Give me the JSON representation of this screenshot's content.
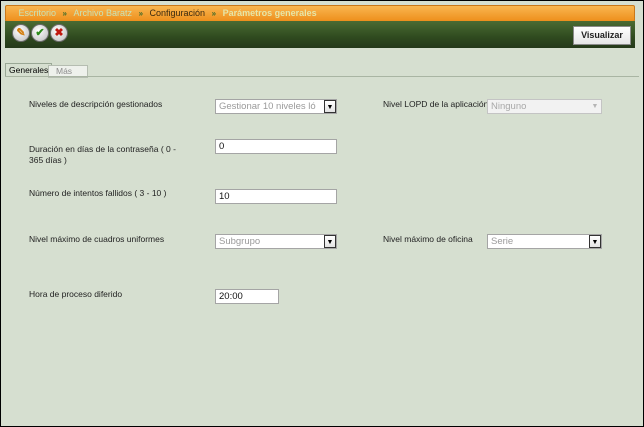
{
  "breadcrumb": {
    "items": [
      "Escritorio",
      "Archivo Baratz",
      "Configuración",
      "Parámetros generales"
    ],
    "separator": "»"
  },
  "toolbar": {
    "edit_icon": "pencil-icon",
    "ok_icon": "checkmark-icon",
    "cancel_icon": "cross-icon",
    "visualizar_label": "Visualizar"
  },
  "tabs": [
    {
      "label": "Generales",
      "active": true
    },
    {
      "label": "Más",
      "active": false
    }
  ],
  "form": {
    "niveles_descripcion": {
      "label": "Niveles de descripción gestionados",
      "value": "Gestionar 10 niveles ló"
    },
    "nivel_lopd": {
      "label": "Nivel LOPD de la aplicación",
      "value": "Ninguno"
    },
    "duracion_contrasena": {
      "label": "Duración en días de la contraseña ( 0 - 365 días )",
      "value": "0"
    },
    "intentos_fallidos": {
      "label": "Número de intentos fallidos ( 3 - 10 )",
      "value": "10"
    },
    "nivel_cuadros": {
      "label": "Nivel máximo de cuadros uniformes",
      "value": "Subgrupo"
    },
    "nivel_oficina": {
      "label": "Nivel máximo de oficina",
      "value": "Serie"
    },
    "hora_proceso": {
      "label": "Hora de proceso diferido",
      "value": "20:00"
    }
  },
  "colors": {
    "breadcrumb_bar": "#f4a335",
    "toolbar_band": "#3a5527",
    "panel_background": "#d6dfd0"
  }
}
